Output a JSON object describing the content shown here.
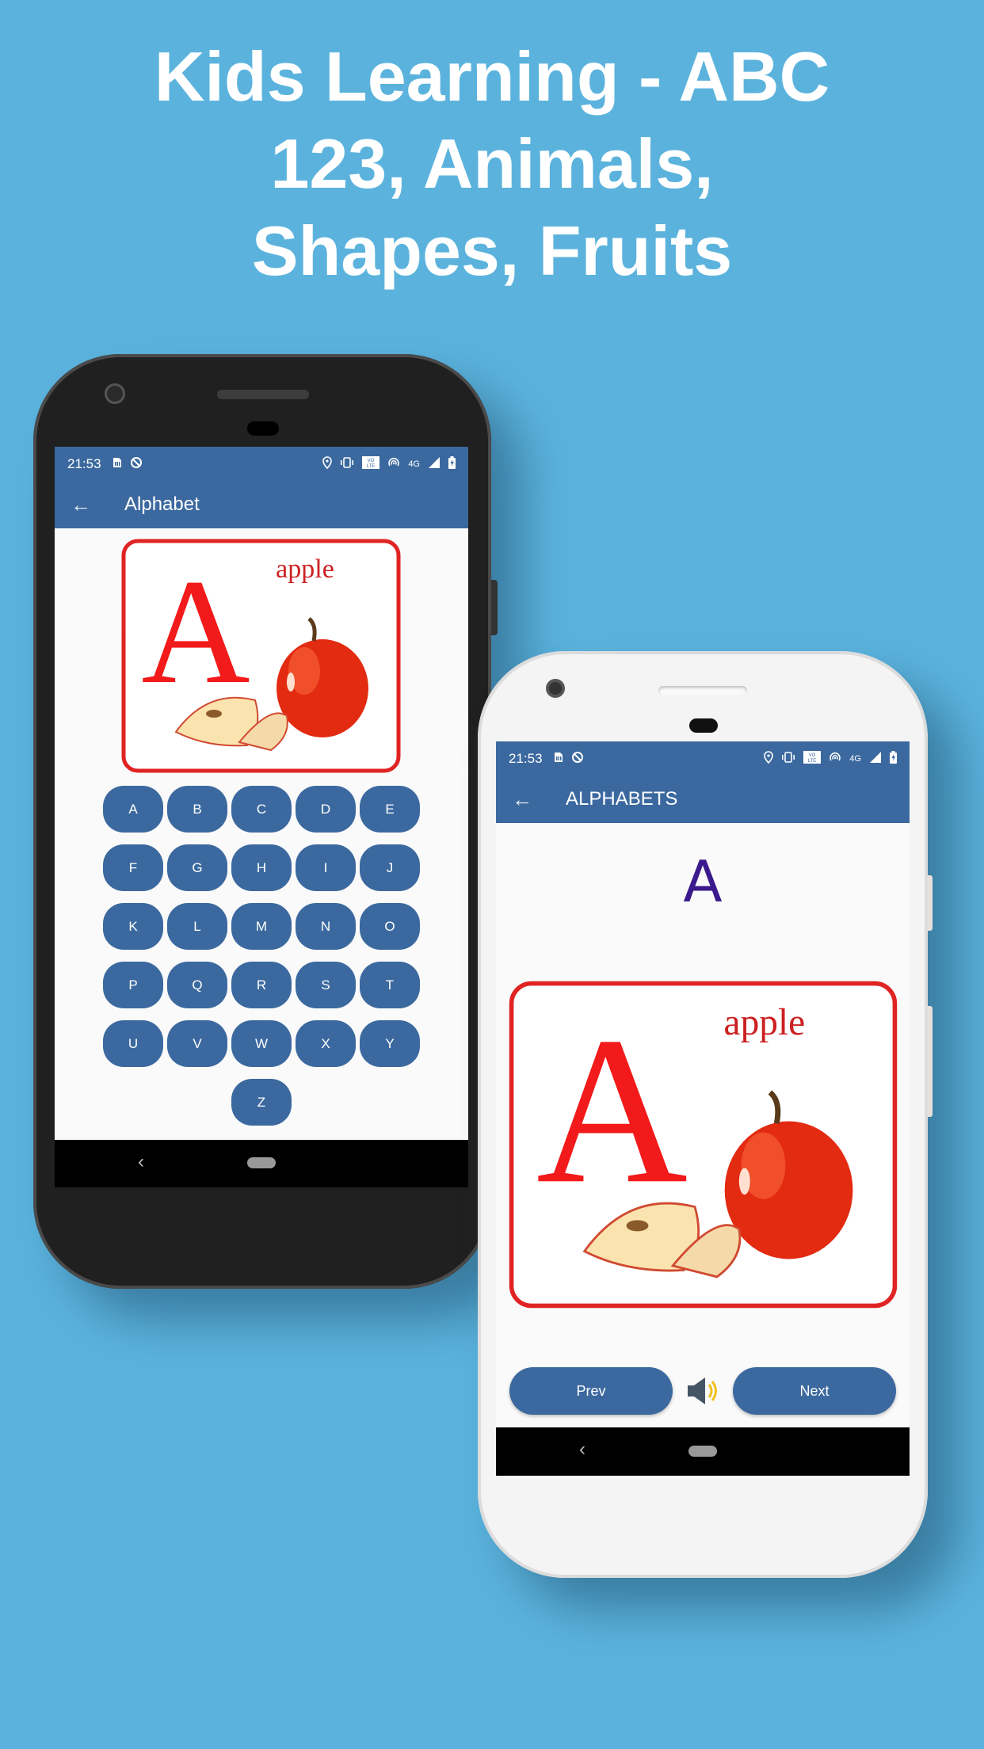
{
  "headline": {
    "lines": [
      "Kids Learning - ABC",
      "123, Animals,",
      "Shapes, Fruits"
    ]
  },
  "colors": {
    "background": "#5bb3dd",
    "primary": "#3b699f",
    "card_border": "#e02424",
    "letter_color": "#3a1a8c",
    "speaker_wave": "#f2c01c"
  },
  "status_bar": {
    "time": "21:53",
    "left_icons": [
      "sim-icon",
      "dnd-off-icon"
    ],
    "right_icons": [
      "location-icon",
      "vibrate-icon",
      "volte-icon",
      "hotspot-icon",
      "4g-icon",
      "signal-icon",
      "battery-charging-icon"
    ],
    "network": "4G",
    "volte": "VO LTE"
  },
  "left_phone": {
    "app_bar": {
      "back_icon": "arrow-left-icon",
      "title": "Alphabet"
    },
    "card": {
      "letter": "A",
      "word": "apple"
    },
    "letters": [
      [
        "A",
        "B",
        "C",
        "D",
        "E"
      ],
      [
        "F",
        "G",
        "H",
        "I",
        "J"
      ],
      [
        "K",
        "L",
        "M",
        "N",
        "O"
      ],
      [
        "P",
        "Q",
        "R",
        "S",
        "T"
      ],
      [
        "U",
        "V",
        "W",
        "X",
        "Y"
      ],
      [
        "Z"
      ]
    ],
    "nav": {
      "back": "‹"
    }
  },
  "right_phone": {
    "app_bar": {
      "back_icon": "arrow-left-icon",
      "title": "ALPHABETS"
    },
    "current_letter": "A",
    "card": {
      "letter": "A",
      "word": "apple"
    },
    "prev_label": "Prev",
    "next_label": "Next",
    "speaker_icon": "speaker-icon",
    "nav": {
      "back": "‹"
    }
  }
}
